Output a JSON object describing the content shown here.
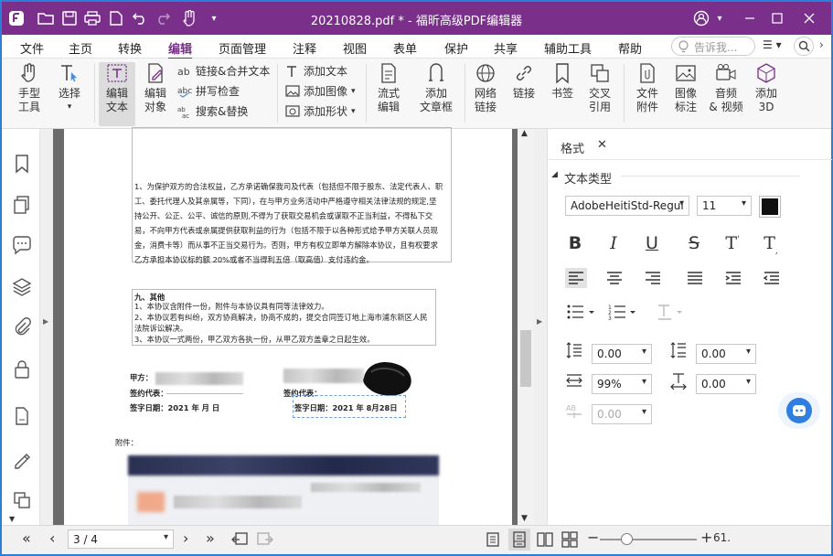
{
  "window": {
    "title": "20210828.pdf * - 福昕高级PDF编辑器",
    "accent": "#7a2f8a"
  },
  "menu": {
    "items": [
      "文件",
      "主页",
      "转换",
      "编辑",
      "页面管理",
      "注释",
      "视图",
      "表单",
      "保护",
      "共享",
      "辅助工具",
      "帮助"
    ],
    "active": "编辑",
    "search_placeholder": "告诉我..."
  },
  "ribbon": {
    "hand": "手型\n工具",
    "select": "选择",
    "edit_text": "编辑\n文本",
    "edit_object": "编辑\n对象",
    "link_merge": "链接&合并文本",
    "spellcheck": "拼写检查",
    "search_replace": "搜索&替换",
    "add_text": "添加文本",
    "add_image": "添加图像",
    "add_shape": "添加形状",
    "flow_edit": "流式\n编辑",
    "add_textframe": "添加\n文章框",
    "web_link": "网络\n链接",
    "link": "链接",
    "bookmark": "书签",
    "cross_ref": "交叉\n引用",
    "file_attach": "文件\n附件",
    "image_annot": "图像\n标注",
    "audio_video": "音频\n& 视频",
    "add_3d": "添加\n3D"
  },
  "document": {
    "para1": [
      "1、为保护双方的合法权益，乙方承诺确保我司及代表（包括但不限于股东、法定代表人、职",
      "工、委托代理人及其亲属等，下同），在与甲方业务活动中严格遵守相关法律法规的规定,坚",
      "持公开、公正、公平、诚信的原则,不得为了获取交易机会或谋取不正当利益，不得私下交",
      "易，不向甲方代表或亲属提供获取利益的行为（包括不限于以各种形式给予甲方关联人员现",
      "金，消费卡等）而从事不正当交易行为。否则，甲方有权立即单方解除本协议，且有权要求",
      "乙方承担本协议标的额 20%或者不当得利五倍（取高值）支付违约金。"
    ],
    "section9_title": "九、其他",
    "section9": [
      "1、本协议含附件一份，附件与本协议具有同等法律效力。",
      "2、本协议若有纠纷，双方协商解决，协商不成的，提交合同签订地上海市浦东新区人民",
      "法院诉讼解决。",
      "3、本协议一式两份，甲乙双方各执一份，从甲乙双方盖章之日起生效。"
    ],
    "party_a": "甲方：",
    "rep_a": "签约代表：",
    "date_a": "签字日期：2021 年     月     日",
    "party_b": "乙方：",
    "rep_b": "签约代表：",
    "date_b": "签字日期：2021 年  8月28日",
    "attachment": "附件："
  },
  "panel": {
    "tab": "格式",
    "section": "文本类型",
    "font": "AdobeHeitiStd-Regul",
    "size": "11",
    "color": "#111111",
    "line_spacing": "0.00",
    "para_spacing": "0.00",
    "scale": "99%",
    "char_spacing": "0.00",
    "baseline": "0.00"
  },
  "status": {
    "page": "3 / 4",
    "zoom": "61."
  }
}
